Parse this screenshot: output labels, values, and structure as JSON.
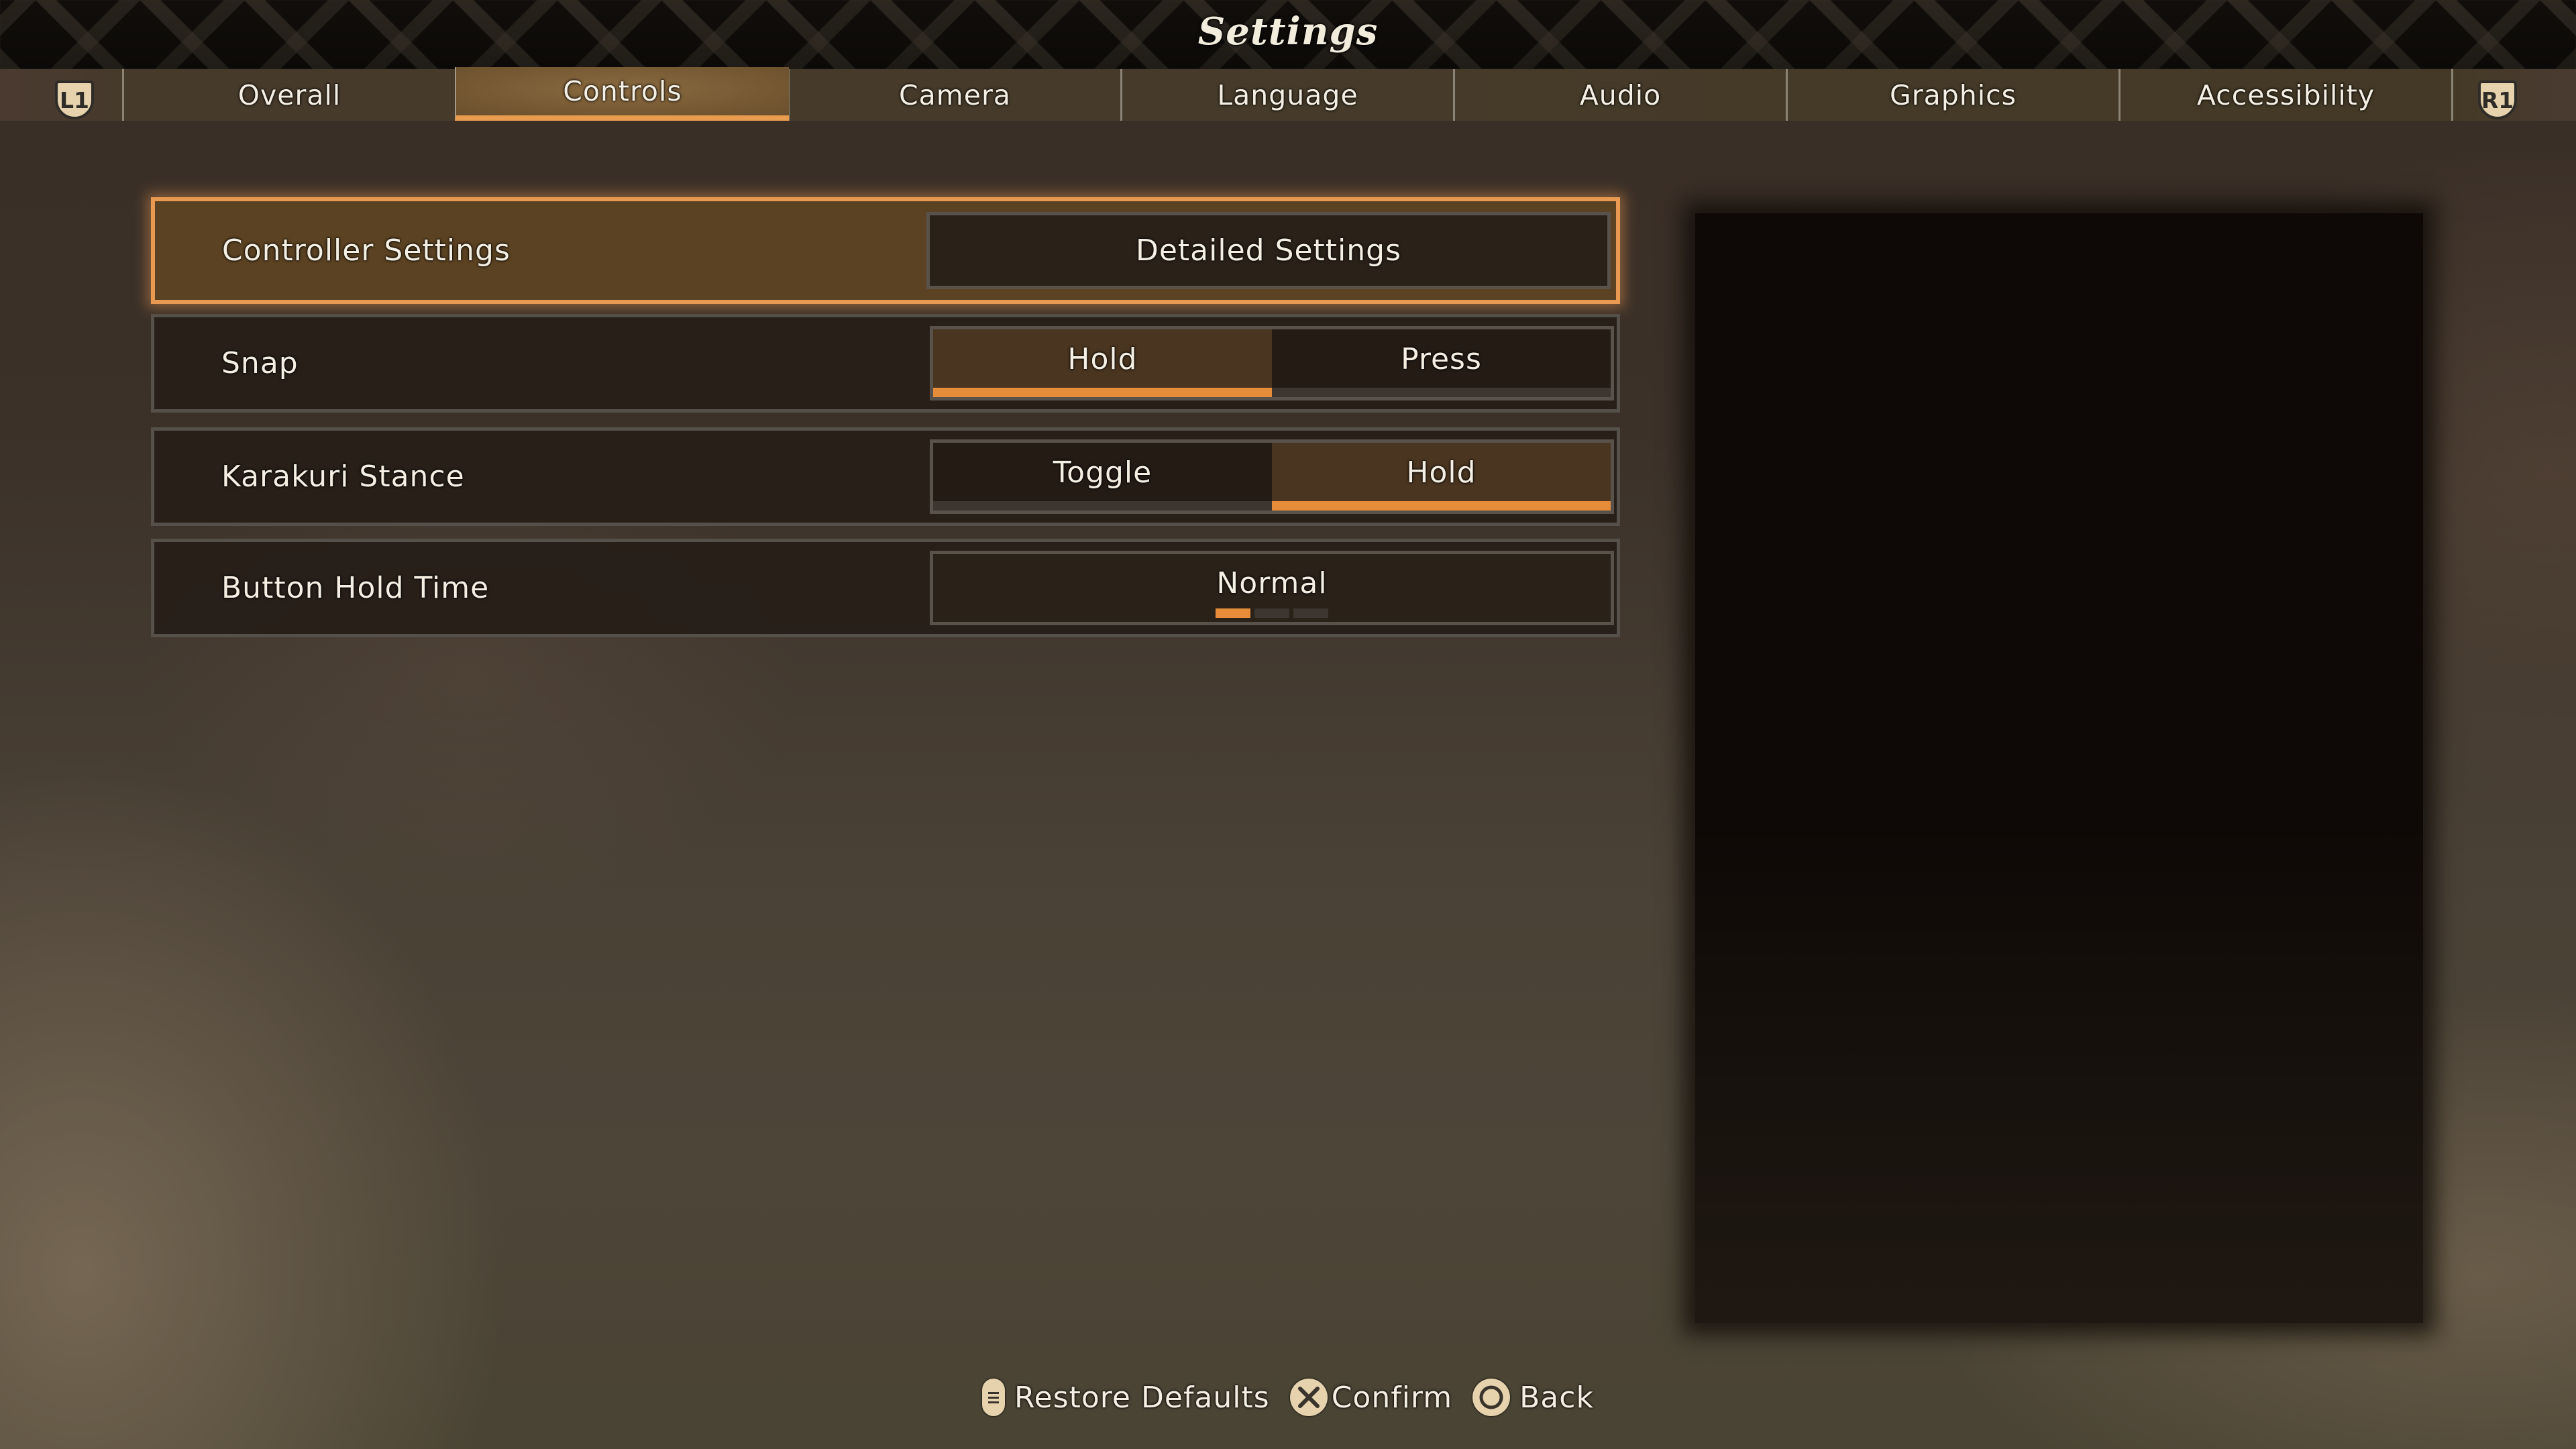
{
  "header": {
    "title": "Settings"
  },
  "tabs": {
    "prev_bumper": "L1",
    "next_bumper": "R1",
    "items": [
      {
        "label": "Overall",
        "active": false
      },
      {
        "label": "Controls",
        "active": true
      },
      {
        "label": "Camera",
        "active": false
      },
      {
        "label": "Language",
        "active": false
      },
      {
        "label": "Audio",
        "active": false
      },
      {
        "label": "Graphics",
        "active": false
      },
      {
        "label": "Accessibility",
        "active": false
      }
    ]
  },
  "settings": {
    "rows": [
      {
        "label": "Controller Settings",
        "type": "button",
        "button_label": "Detailed Settings",
        "focused": true
      },
      {
        "label": "Snap",
        "type": "segmented",
        "options": [
          "Hold",
          "Press"
        ],
        "selected": "Hold"
      },
      {
        "label": "Karakuri Stance",
        "type": "segmented",
        "options": [
          "Toggle",
          "Hold"
        ],
        "selected": "Hold"
      },
      {
        "label": "Button Hold Time",
        "type": "selector",
        "value": "Normal",
        "option_count": 3,
        "selected_index": 0
      }
    ]
  },
  "footer": {
    "prompts": [
      {
        "icon": "options-button-icon",
        "label": "Restore Defaults"
      },
      {
        "icon": "cross-button-icon",
        "label": "Confirm"
      },
      {
        "icon": "circle-button-icon",
        "label": "Back"
      }
    ]
  },
  "colors": {
    "accent": "#e78d3a",
    "focus_fill": "#5b4222",
    "selected_segment": "#4a3520",
    "text": "#f4efe2"
  }
}
